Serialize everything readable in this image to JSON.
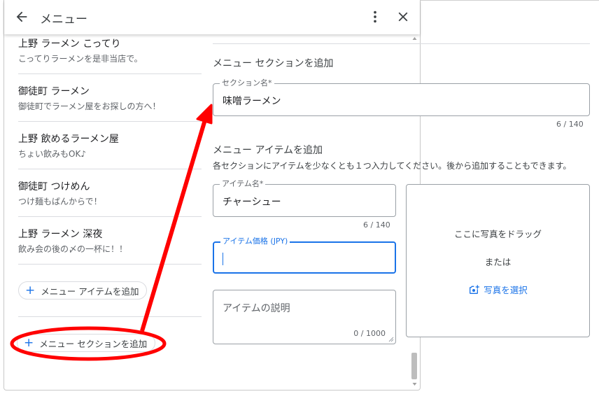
{
  "header": {
    "title": "メニュー",
    "back_icon": "arrow-back-icon",
    "more_icon": "more-vertical-icon",
    "close_icon": "close-icon"
  },
  "sidebar": {
    "items": [
      {
        "title": "上野 ラーメン こってり",
        "description": "こってりラーメンを是非当店で。"
      },
      {
        "title": "御徒町 ラーメン",
        "description": "御徒町でラーメン屋をお探しの方へ！"
      },
      {
        "title": "上野 飲めるラーメン屋",
        "description": "ちょい飲みもOK♪"
      },
      {
        "title": "御徒町 つけめん",
        "description": "つけ麺もばんからで！"
      },
      {
        "title": "上野 ラーメン 深夜",
        "description": "飲み会の後の〆の一杯に！！"
      }
    ],
    "add_item_label": "メニュー アイテムを追加",
    "add_section_label": "メニュー セクションを追加"
  },
  "section_form": {
    "title": "メニュー セクションを追加",
    "name_label": "セクション名*",
    "name_value": "味噌ラーメン",
    "name_counter": "6 / 140"
  },
  "item_form": {
    "title": "メニュー アイテムを追加",
    "hint": "各セクションにアイテムを少なくとも１つ入力してください。後から追加することもできます。",
    "name_label": "アイテム名*",
    "name_value": "チャーシュー",
    "name_counter": "6 / 140",
    "price_label": "アイテム価格 (JPY)",
    "price_value": "",
    "description_placeholder": "アイテムの説明",
    "description_counter": "0 / 1000"
  },
  "photo": {
    "drag_text": "ここに写真をドラッグ",
    "or_text": "または",
    "select_label": "写真を選択",
    "select_icon": "add-photo-icon"
  },
  "colors": {
    "accent": "#1a73e8",
    "annotation": "#ff0000"
  }
}
